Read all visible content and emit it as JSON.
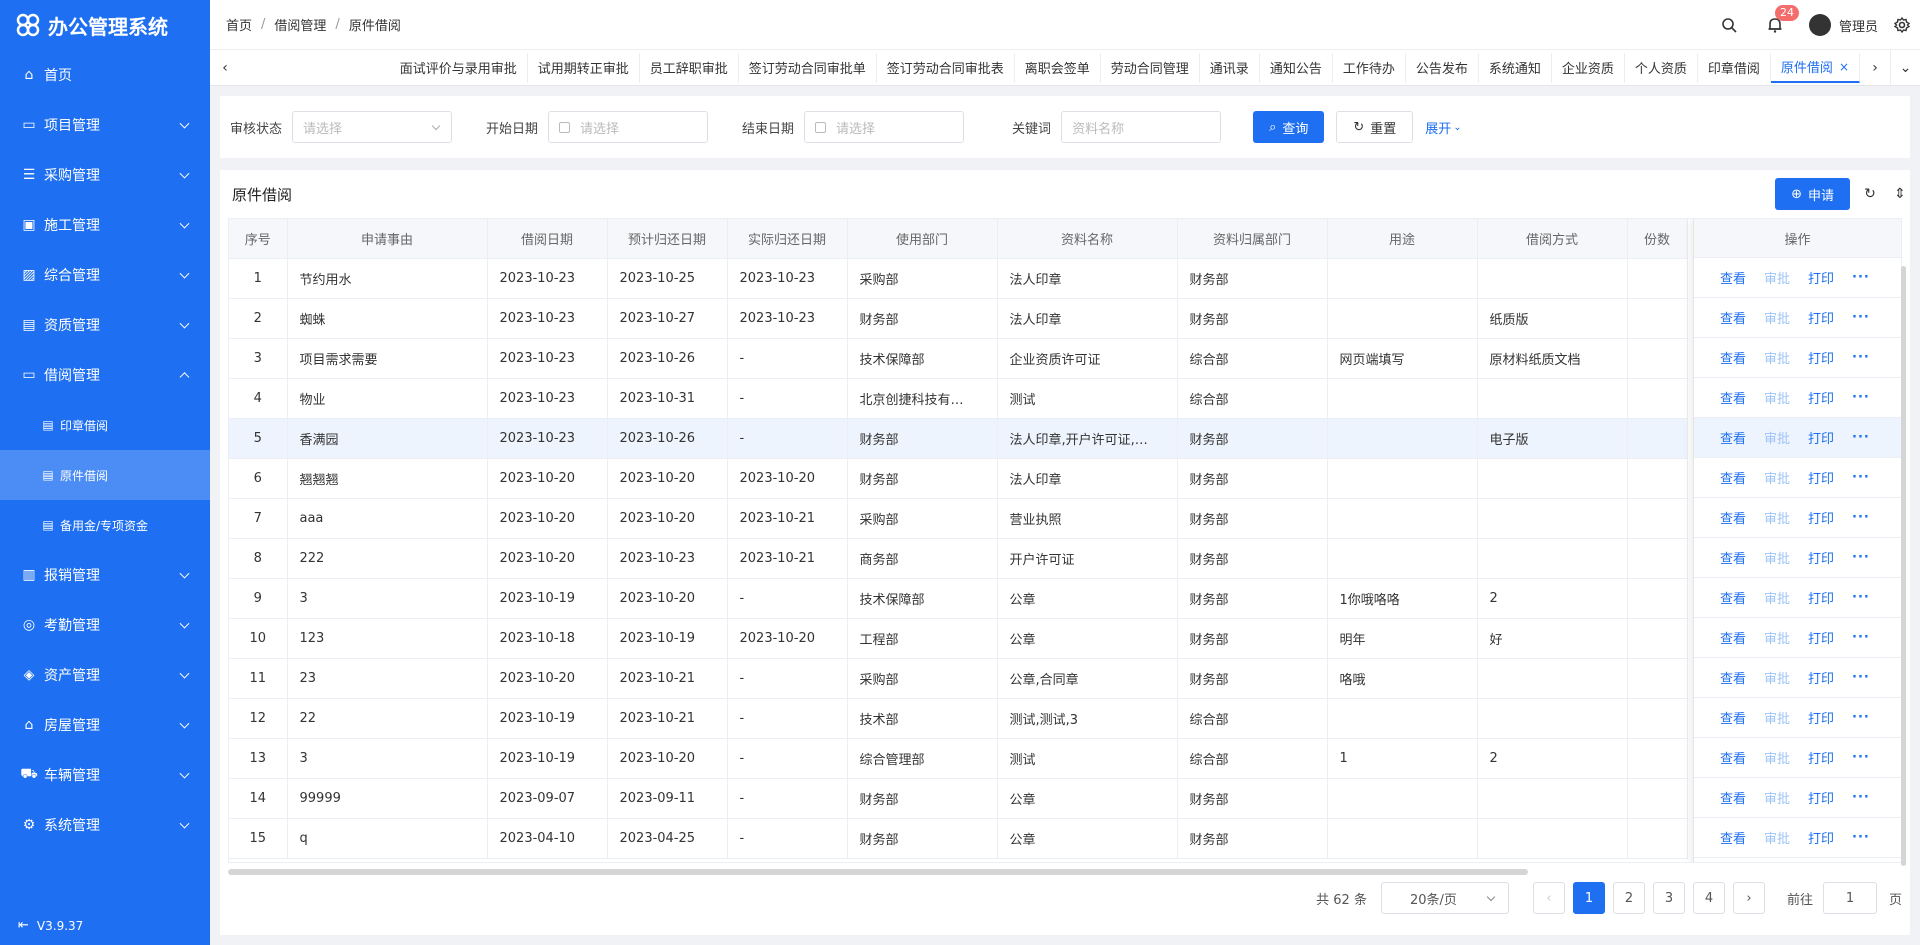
{
  "app": {
    "title": "办公管理系统",
    "version": "V3.9.37",
    "accent": "#1e6ff1"
  },
  "sidebar": {
    "items": [
      {
        "label": "首页",
        "icon": "home-icon"
      },
      {
        "label": "项目管理",
        "icon": "folder-icon"
      },
      {
        "label": "采购管理",
        "icon": "list-icon"
      },
      {
        "label": "施工管理",
        "icon": "image-icon"
      },
      {
        "label": "综合管理",
        "icon": "picture-icon"
      },
      {
        "label": "资质管理",
        "icon": "certificate-icon"
      },
      {
        "label": "借阅管理",
        "icon": "folder-icon",
        "expanded": true
      },
      {
        "label": "报销管理",
        "icon": "wallet-icon"
      },
      {
        "label": "考勤管理",
        "icon": "target-icon"
      },
      {
        "label": "资产管理",
        "icon": "layers-icon"
      },
      {
        "label": "房屋管理",
        "icon": "house-icon"
      },
      {
        "label": "车辆管理",
        "icon": "car-icon"
      },
      {
        "label": "系统管理",
        "icon": "gear-icon"
      }
    ],
    "sub_items": [
      {
        "label": "印章借阅"
      },
      {
        "label": "原件借阅",
        "active": true
      },
      {
        "label": "备用金/专项资金"
      }
    ]
  },
  "header": {
    "breadcrumb": [
      "首页",
      "借阅管理",
      "原件借阅"
    ],
    "notification_count": "24",
    "user_name": "管理员"
  },
  "tabs": [
    "面试评价与录用审批",
    "试用期转正审批",
    "员工辞职审批",
    "签订劳动合同审批单",
    "签订劳动合同审批表",
    "离职会签单",
    "劳动合同管理",
    "通讯录",
    "通知公告",
    "工作待办",
    "公告发布",
    "系统通知",
    "企业资质",
    "个人资质",
    "印章借阅",
    "原件借阅"
  ],
  "filter": {
    "status_label": "审核状态",
    "status_placeholder": "请选择",
    "start_label": "开始日期",
    "start_placeholder": "请选择",
    "end_label": "结束日期",
    "end_placeholder": "请选择",
    "keyword_label": "关键词",
    "keyword_placeholder": "资料名称",
    "search_btn": "查询",
    "reset_btn": "重置",
    "expand_btn": "展开"
  },
  "card": {
    "title": "原件借阅",
    "apply_btn": "申请"
  },
  "table": {
    "columns": [
      "序号",
      "申请事由",
      "借阅日期",
      "预计归还日期",
      "实际归还日期",
      "使用部门",
      "资料名称",
      "资料归属部门",
      "用途",
      "借阅方式",
      "份数",
      "操作"
    ],
    "ops": {
      "view": "查看",
      "approve": "审批",
      "print": "打印",
      "more": "···"
    },
    "rows": [
      [
        "1",
        "节约用水",
        "2023-10-23",
        "2023-10-25",
        "2023-10-23",
        "采购部",
        "法人印章",
        "财务部",
        "",
        "",
        ""
      ],
      [
        "2",
        "蜘蛛",
        "2023-10-23",
        "2023-10-27",
        "2023-10-23",
        "财务部",
        "法人印章",
        "财务部",
        "",
        "纸质版",
        ""
      ],
      [
        "3",
        "项目需求需要",
        "2023-10-23",
        "2023-10-26",
        "-",
        "技术保障部",
        "企业资质许可证",
        "综合部",
        "网页端填写",
        "原材料纸质文档",
        ""
      ],
      [
        "4",
        "物业",
        "2023-10-23",
        "2023-10-31",
        "-",
        "北京创捷科技有…",
        "测试",
        "综合部",
        "",
        "",
        ""
      ],
      [
        "5",
        "香满园",
        "2023-10-23",
        "2023-10-26",
        "-",
        "财务部",
        "法人印章,开户许可证,…",
        "财务部",
        "",
        "电子版",
        ""
      ],
      [
        "6",
        "翘翘翘",
        "2023-10-20",
        "2023-10-20",
        "2023-10-20",
        "财务部",
        "法人印章",
        "财务部",
        "",
        "",
        ""
      ],
      [
        "7",
        "aaa",
        "2023-10-20",
        "2023-10-20",
        "2023-10-21",
        "采购部",
        "营业执照",
        "财务部",
        "",
        "",
        ""
      ],
      [
        "8",
        "222",
        "2023-10-20",
        "2023-10-23",
        "2023-10-21",
        "商务部",
        "开户许可证",
        "财务部",
        "",
        "",
        ""
      ],
      [
        "9",
        "3",
        "2023-10-19",
        "2023-10-20",
        "-",
        "技术保障部",
        "公章",
        "财务部",
        "1你哦咯咯",
        "2",
        ""
      ],
      [
        "10",
        "123",
        "2023-10-18",
        "2023-10-19",
        "2023-10-20",
        "工程部",
        "公章",
        "财务部",
        "明年",
        "好",
        ""
      ],
      [
        "11",
        "23",
        "2023-10-20",
        "2023-10-21",
        "-",
        "采购部",
        "公章,合同章",
        "财务部",
        "咯哦",
        "",
        ""
      ],
      [
        "12",
        "22",
        "2023-10-19",
        "2023-10-21",
        "-",
        "技术部",
        "测试,测试,3",
        "综合部",
        "",
        "",
        ""
      ],
      [
        "13",
        "3",
        "2023-10-19",
        "2023-10-20",
        "-",
        "综合管理部",
        "测试",
        "综合部",
        "1",
        "2",
        ""
      ],
      [
        "14",
        "99999",
        "2023-09-07",
        "2023-09-11",
        "-",
        "财务部",
        "公章",
        "财务部",
        "",
        "",
        ""
      ],
      [
        "15",
        "q",
        "2023-04-10",
        "2023-04-25",
        "-",
        "财务部",
        "公章",
        "财务部",
        "",
        "",
        ""
      ]
    ],
    "highlight_row": 5
  },
  "pager": {
    "total": "共 62 条",
    "page_size": "20条/页",
    "pages": [
      "1",
      "2",
      "3",
      "4"
    ],
    "current": "1",
    "goto_label": "前往",
    "goto_value": "1",
    "page_unit": "页"
  }
}
